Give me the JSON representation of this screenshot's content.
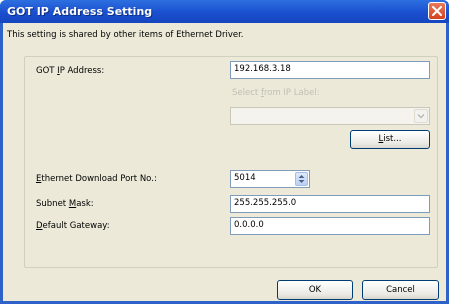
{
  "window": {
    "title": "GOT IP Address Setting"
  },
  "dialog": {
    "note": "This setting is shared by other items of Ethernet Driver."
  },
  "got_ip": {
    "label_pre": "GOT ",
    "label_mnemonic": "I",
    "label_post": "P Address:",
    "value": "192.168.3.18"
  },
  "ip_label": {
    "caption_pre": "Select ",
    "caption_mnemonic": "f",
    "caption_post": "rom IP Label:",
    "selected": ""
  },
  "list_button": {
    "label_mnemonic": "L",
    "label_post": "ist..."
  },
  "download_port": {
    "label_mnemonic": "E",
    "label_post": "thernet Download Port No.:",
    "value": "5014"
  },
  "subnet_mask": {
    "label_pre": "Subnet ",
    "label_mnemonic": "M",
    "label_post": "ask:",
    "value": "255.255.255.0"
  },
  "default_gateway": {
    "label_mnemonic": "D",
    "label_post": "efault Gateway:",
    "value": "0.0.0.0"
  },
  "buttons": {
    "ok": "OK",
    "cancel": "Cancel"
  },
  "icons": {
    "close": "close-icon",
    "combo_arrow": "chevron-down-icon",
    "spin": "spin-updown-icon"
  }
}
